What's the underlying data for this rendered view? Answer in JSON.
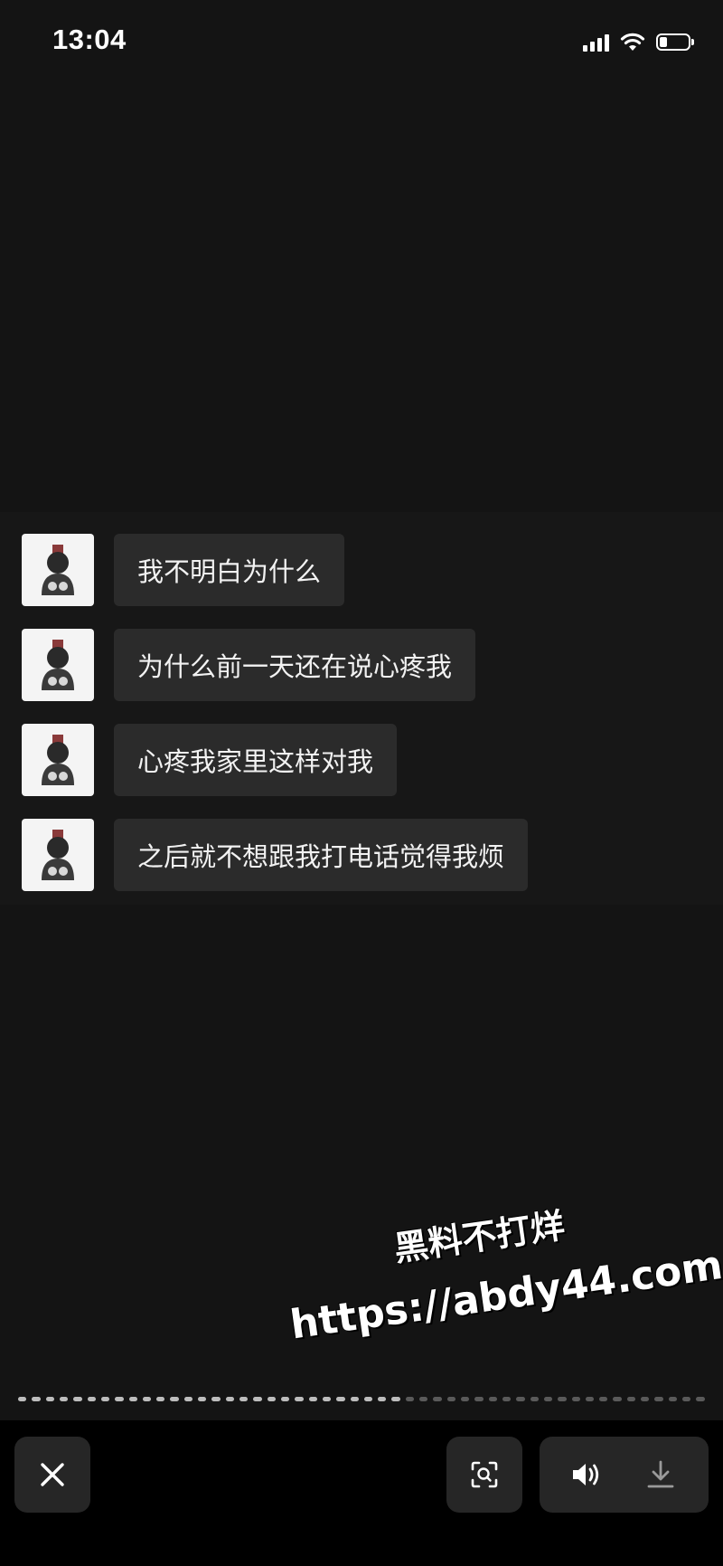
{
  "status_bar": {
    "time": "13:04",
    "battery_level": 0.2
  },
  "messages": [
    {
      "text": "我不明白为什么"
    },
    {
      "text": "为什么前一天还在说心疼我"
    },
    {
      "text": "心疼我家里这样对我"
    },
    {
      "text": "之后就不想跟我打电话觉得我烦"
    }
  ],
  "watermark": {
    "line1": "黑料不打烊",
    "line2": "https://abdy44.com"
  },
  "playback": {
    "progress": 0.55
  },
  "controls": {
    "close_icon": "close-icon",
    "scan_icon": "scan-icon",
    "volume_icon": "volume-icon",
    "download_icon": "download-icon"
  }
}
